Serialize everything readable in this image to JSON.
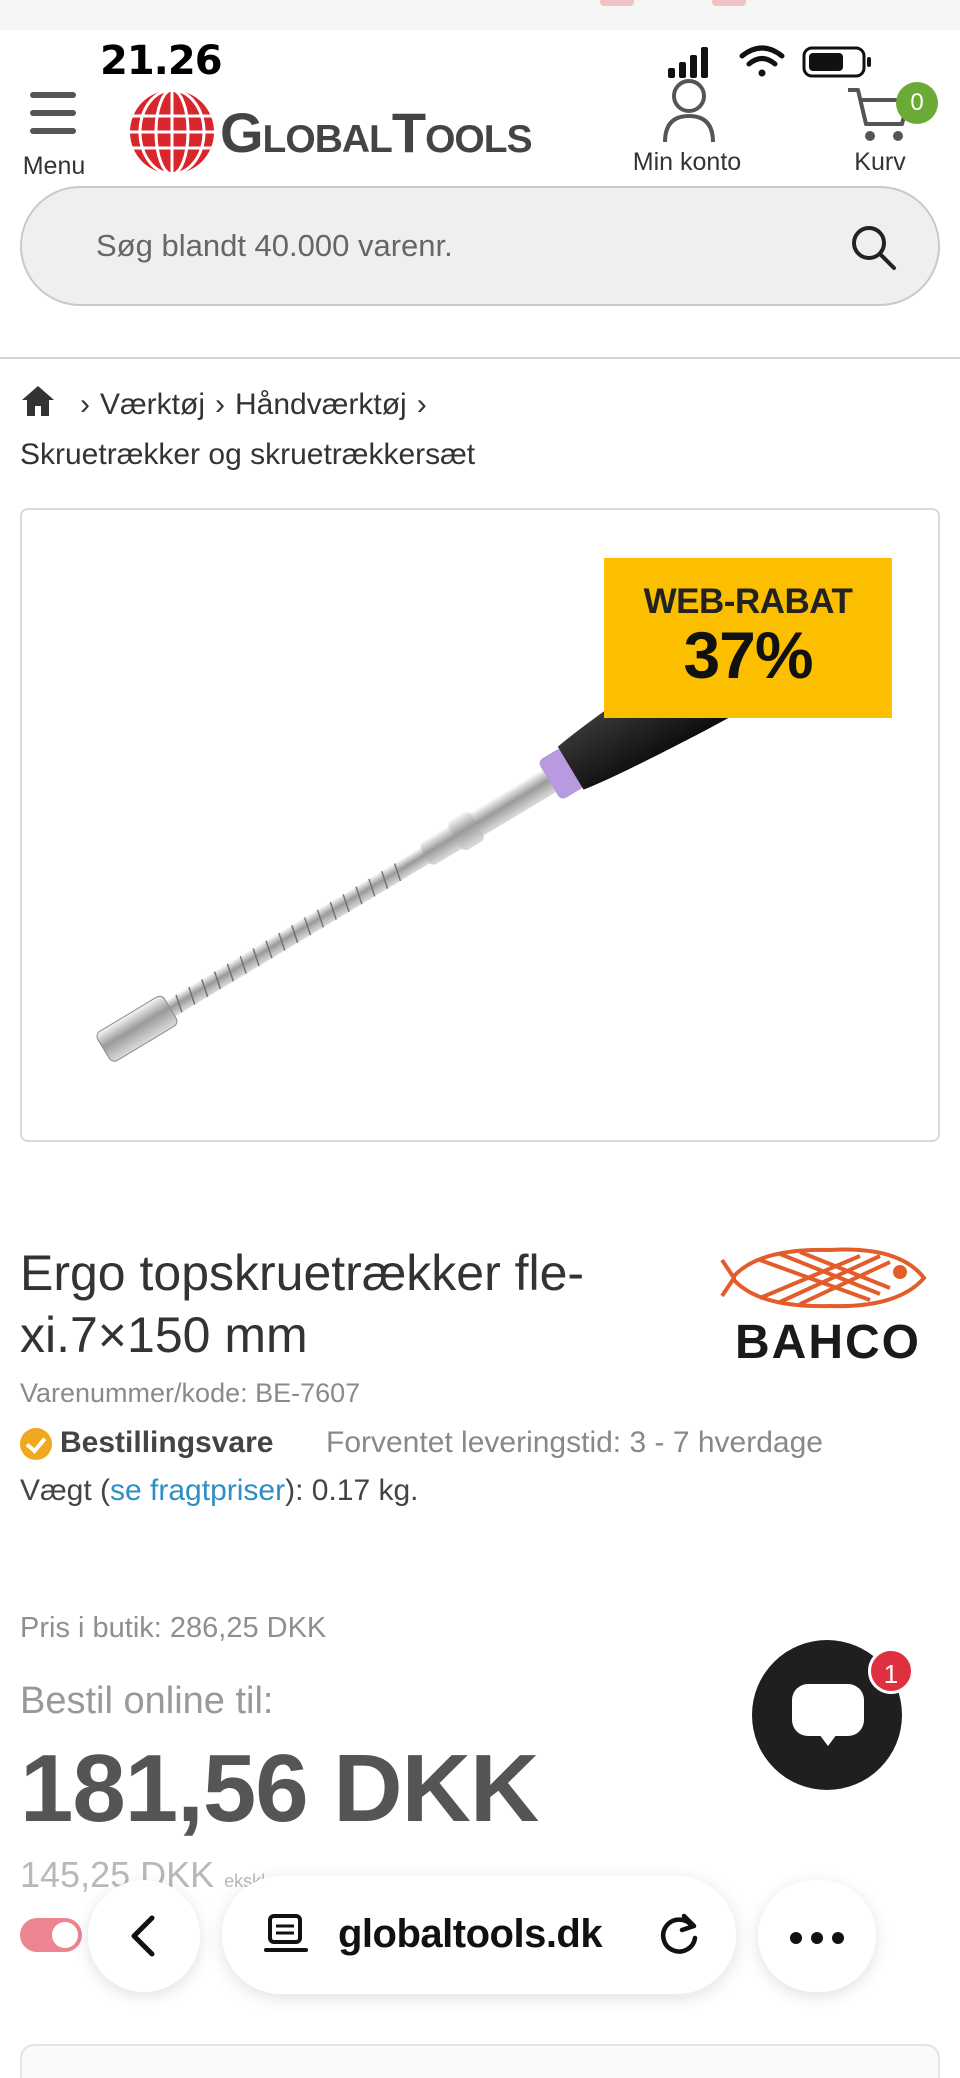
{
  "status_bar": {
    "time": "21.26"
  },
  "header": {
    "menu_label": "Menu",
    "logo_text": "GlobalTools",
    "account_label": "Min konto",
    "cart_label": "Kurv",
    "cart_count": "0"
  },
  "search": {
    "placeholder": "Søg blandt 40.000 varenr."
  },
  "breadcrumb": {
    "items": [
      "Værktøj",
      "Håndværktøj",
      "Skruetrækker og skruetrækkersæt"
    ]
  },
  "product": {
    "badge_line1": "WEB-RABAT",
    "badge_line2": "37%",
    "title": "Ergo topskruetrækker fle-xi.7×150 mm",
    "brand": "BAHCO",
    "sku": "Varenummer/kode: BE-7607",
    "stock_status": "Bestillingsvare",
    "delivery": "Forventet leveringstid: 3 - 7 hverdage",
    "weight_prefix": "Vægt (",
    "weight_link": "se fragtpriser",
    "weight_suffix": "): 0.17 kg.",
    "store_price": "Pris i butik: 286,25 DKK",
    "order_label": "Bestil online til:",
    "price": "181,56 DKK",
    "price_excl": "145,25 DKK",
    "price_excl_suffix": "ekskl."
  },
  "chat": {
    "badge": "1"
  },
  "browser": {
    "domain": "globaltools.dk"
  },
  "colors": {
    "badge": "#fcbf00",
    "cart_badge": "#6aaa35",
    "chat_badge": "#e0303f",
    "link": "#2e8fc4",
    "logo_red": "#d9262c",
    "brand_orange": "#e35d2b"
  }
}
